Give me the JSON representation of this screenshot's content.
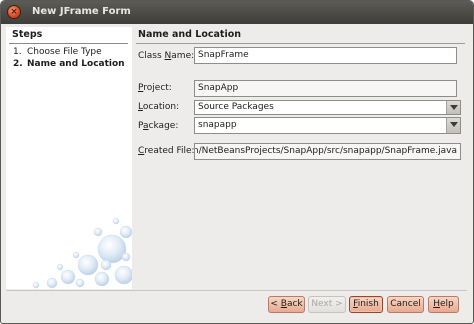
{
  "window": {
    "title": "New JFrame Form"
  },
  "steps": {
    "heading": "Steps",
    "items": [
      {
        "number": "1.",
        "label": "Choose File Type"
      },
      {
        "number": "2.",
        "label": "Name and Location"
      }
    ]
  },
  "content": {
    "heading": "Name and Location",
    "class_name": {
      "label_pre": "Class ",
      "label_key": "N",
      "label_post": "ame:",
      "value": "SnapFrame"
    },
    "project": {
      "label_key": "P",
      "label_post": "roject:",
      "value": "SnapApp"
    },
    "location": {
      "label_key": "L",
      "label_post": "ocation:",
      "value": "Source Packages"
    },
    "package": {
      "label_pre": "P",
      "label_key": "a",
      "label_post": "ckage:",
      "value": "snapapp"
    },
    "created_file": {
      "label_key": "C",
      "label_post": "reated File:",
      "value": "nathan/NetBeansProjects/SnapApp/src/snapapp/SnapFrame.java"
    }
  },
  "buttons": {
    "back": {
      "pre": "< ",
      "key": "B",
      "post": "ack"
    },
    "next": {
      "label": "Next >"
    },
    "finish": {
      "key": "F",
      "post": "inish"
    },
    "cancel": {
      "label": "Cancel"
    },
    "help": {
      "key": "H",
      "post": "elp"
    }
  }
}
